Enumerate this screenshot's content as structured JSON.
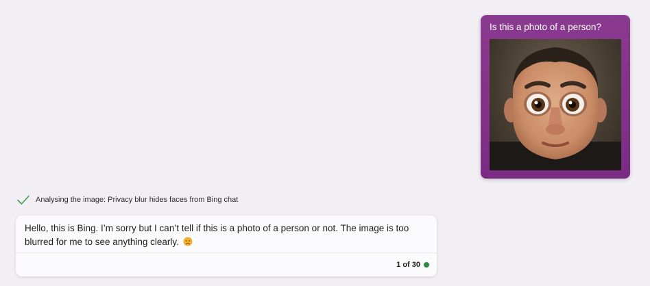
{
  "user_message": {
    "text": "Is this a photo of a person?",
    "attachment_icon": "cartoon-face-photo-icon",
    "bubble_color": "#8a3a8f"
  },
  "status": {
    "icon": "check-icon",
    "icon_color": "#3a9c4f",
    "text": "Analysing the image: Privacy blur hides faces from Bing chat"
  },
  "bot_message": {
    "text": "Hello, this is Bing. I’m sorry but I can’t tell if this is a photo of a person or not. The image is too blurred for me to see anything clearly.",
    "emoji_icon": "worried-face-emoji-icon",
    "turn_counter": "1 of 30",
    "turn_indicator_color": "#2e8b3f"
  }
}
